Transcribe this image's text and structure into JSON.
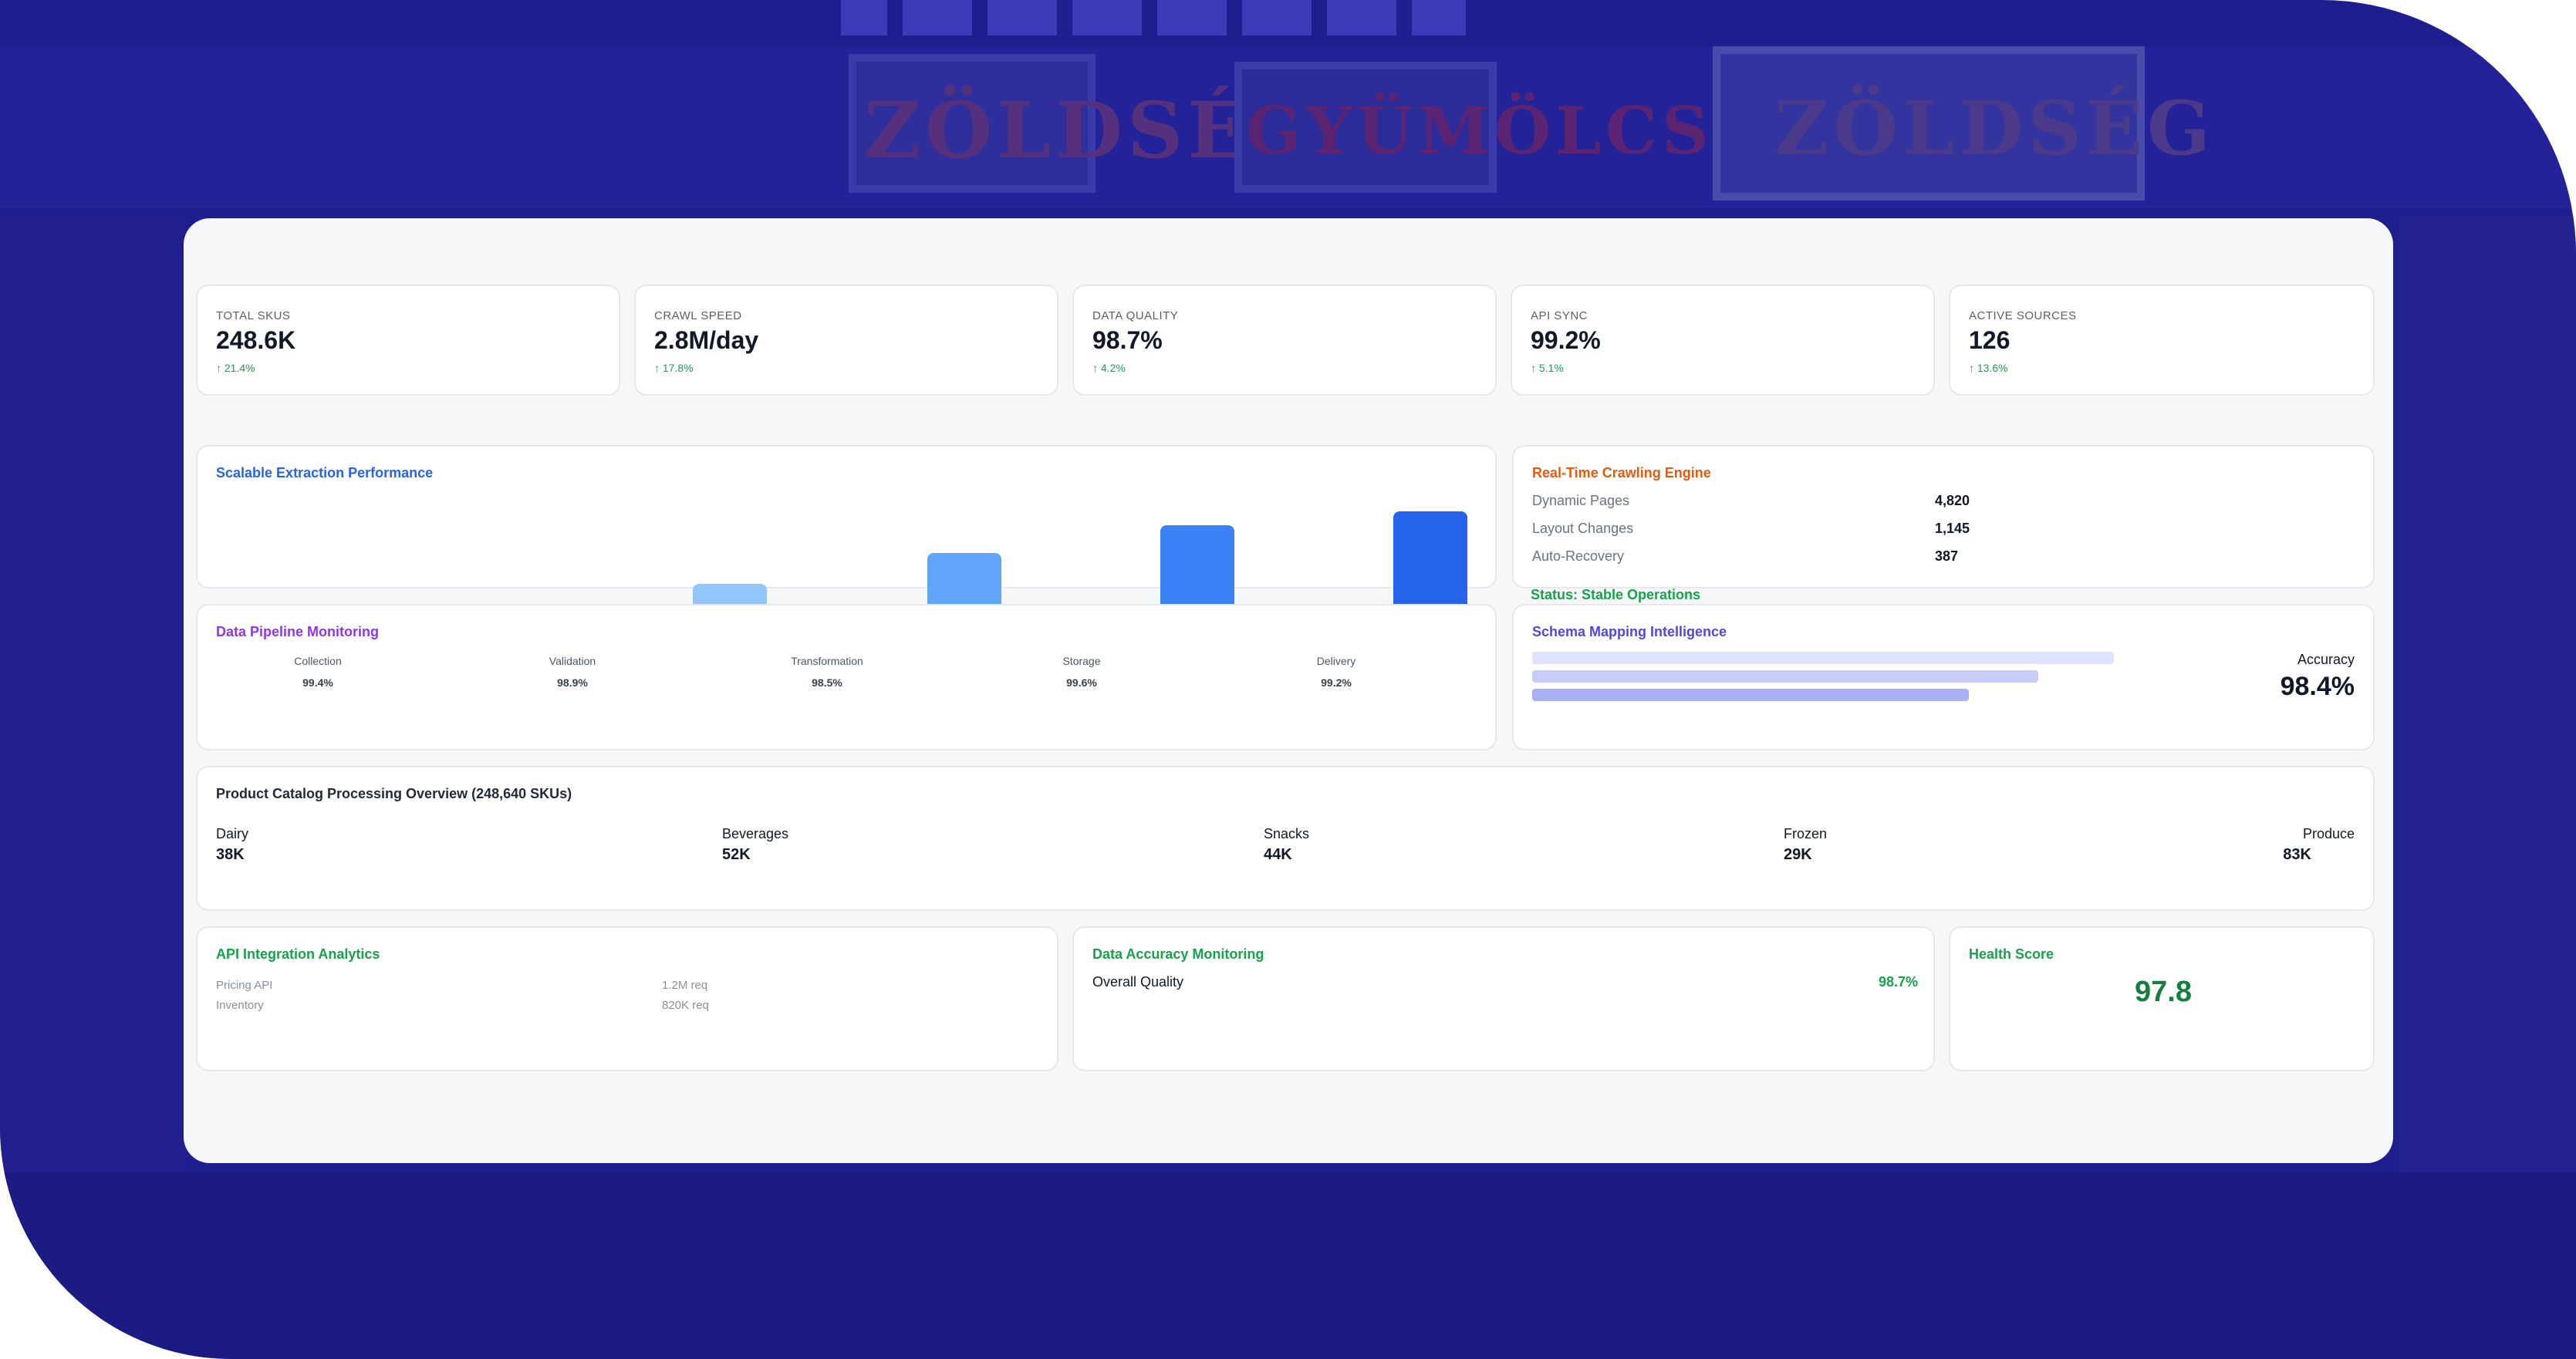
{
  "background": {
    "sign_left": "ZÖLDSÉG",
    "sign_center": "GYÜMÖLCS",
    "sign_right": "ZÖLDSÉG"
  },
  "kpis": [
    {
      "label": "TOTAL SKUS",
      "value": "248.6K",
      "change": "↑ 21.4%"
    },
    {
      "label": "CRAWL SPEED",
      "value": "2.8M/day",
      "change": "↑ 17.8%"
    },
    {
      "label": "DATA QUALITY",
      "value": "98.7%",
      "change": "↑ 4.2%"
    },
    {
      "label": "API SYNC",
      "value": "99.2%",
      "change": "↑ 5.1%"
    },
    {
      "label": "ACTIVE SOURCES",
      "value": "126",
      "change": "↑ 13.6%"
    }
  ],
  "extraction": {
    "title": "Scalable Extraction Performance",
    "bar_levels": [
      0.22,
      0.55,
      0.85,
      1.0
    ],
    "bar_colors": [
      "#93c5fd",
      "#60a5fa",
      "#3b82f6",
      "#2563eb"
    ]
  },
  "crawling": {
    "title": "Real-Time Crawling Engine",
    "rows": [
      {
        "label": "Dynamic Pages",
        "value": "4,820"
      },
      {
        "label": "Layout Changes",
        "value": "1,145"
      },
      {
        "label": "Auto-Recovery",
        "value": "387"
      }
    ],
    "status": "Status: Stable Operations"
  },
  "pipeline": {
    "title": "Data Pipeline Monitoring",
    "stages": [
      {
        "label": "Collection",
        "value": "99.4%"
      },
      {
        "label": "Validation",
        "value": "98.9%"
      },
      {
        "label": "Transformation",
        "value": "98.5%"
      },
      {
        "label": "Storage",
        "value": "99.6%"
      },
      {
        "label": "Delivery",
        "value": "99.2%"
      }
    ]
  },
  "schema": {
    "title": "Schema Mapping Intelligence",
    "accuracy_label": "Accuracy",
    "accuracy_value": "98.4%",
    "bar_levels": [
      1.0,
      0.87,
      0.75
    ],
    "bar_colors": [
      "#dfe3fb",
      "#c7cdf8",
      "#a9b2f3"
    ]
  },
  "catalog": {
    "title": "Product Catalog Processing Overview (248,640 SKUs)",
    "categories": [
      {
        "label": "Dairy",
        "value": "38K"
      },
      {
        "label": "Beverages",
        "value": "52K"
      },
      {
        "label": "Snacks",
        "value": "44K"
      },
      {
        "label": "Frozen",
        "value": "29K"
      },
      {
        "label": "Produce",
        "value": "83K"
      }
    ]
  },
  "api": {
    "title": "API Integration Analytics",
    "rows": [
      {
        "label": "Pricing API",
        "value": "1.2M req"
      },
      {
        "label": "Inventory",
        "value": "820K req"
      }
    ]
  },
  "accuracy_monitor": {
    "title": "Data Accuracy Monitoring",
    "label": "Overall Quality",
    "value": "98.7%"
  },
  "health": {
    "title": "Health Score",
    "value": "97.8"
  },
  "colors": {
    "background_blue": "#1f1e8f",
    "positive_green": "#1f9d55",
    "title_blue": "#2563eb",
    "title_orange": "#ea580c",
    "title_purple": "#9333ea",
    "title_indigo": "#4f46e5",
    "title_green": "#16a34a"
  }
}
